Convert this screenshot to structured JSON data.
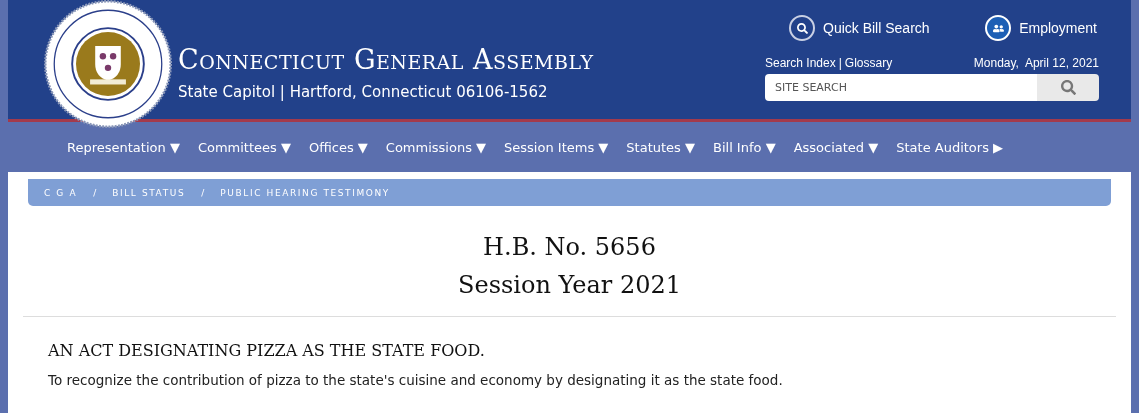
{
  "header": {
    "title": "Connecticut General Assembly",
    "address": "State Capitol | Hartford, Connecticut  06106-1562",
    "quick_links": [
      {
        "kind": "search",
        "label": "Quick Bill Search"
      },
      {
        "kind": "people",
        "label": "Employment"
      }
    ],
    "index_links": [
      "Search Index",
      "Glossary"
    ],
    "index_separator": "|",
    "date": "Monday,  April 12, 2021",
    "site_search": {
      "placeholder": "SITE SEARCH"
    }
  },
  "nav": [
    {
      "label": "Representation",
      "arrow": "▼"
    },
    {
      "label": "Committees",
      "arrow": "▼"
    },
    {
      "label": "Offices",
      "arrow": "▼"
    },
    {
      "label": "Commissions",
      "arrow": "▼"
    },
    {
      "label": "Session Items",
      "arrow": "▼"
    },
    {
      "label": "Statutes",
      "arrow": "▼"
    },
    {
      "label": "Bill Info",
      "arrow": "▼"
    },
    {
      "label": "Associated",
      "arrow": "▼"
    },
    {
      "label": "State Auditors",
      "arrow": "▶"
    }
  ],
  "breadcrumb": [
    "C G A",
    "BILL STATUS",
    "PUBLIC HEARING TESTIMONY"
  ],
  "breadcrumb_separator": "/",
  "bill": {
    "number": "H.B. No. 5656",
    "session": "Session Year 2021",
    "title": "AN ACT DESIGNATING PIZZA AS THE STATE FOOD.",
    "summary": "To recognize the contribution of pizza to the state's cuisine and economy by designating it as the state food."
  }
}
